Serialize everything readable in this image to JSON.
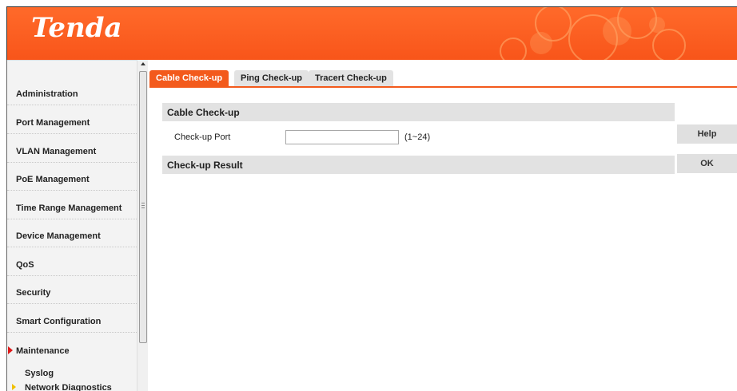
{
  "brand": {
    "logo_text": "Tenda",
    "accent_color": "#f35a1c"
  },
  "sidebar": {
    "items": [
      {
        "label": "Administration"
      },
      {
        "label": "Port Management"
      },
      {
        "label": "VLAN Management"
      },
      {
        "label": "PoE Management"
      },
      {
        "label": "Time Range Management"
      },
      {
        "label": "Device Management"
      },
      {
        "label": "QoS"
      },
      {
        "label": "Security"
      },
      {
        "label": "Smart Configuration"
      },
      {
        "label": "Maintenance",
        "expanded": true
      }
    ],
    "subitems": [
      {
        "label": "Syslog"
      },
      {
        "label": "Network Diagnostics",
        "selected": true
      }
    ]
  },
  "tabs": [
    {
      "label": "Cable Check-up",
      "active": true
    },
    {
      "label": "Ping Check-up",
      "active": false
    },
    {
      "label": "Tracert Check-up",
      "active": false
    }
  ],
  "main": {
    "section1_title": "Cable Check-up",
    "port_label": "Check-up Port",
    "port_value": "",
    "port_hint": "(1~24)",
    "section2_title": "Check-up Result"
  },
  "buttons": {
    "help_label": "Help",
    "ok_label": "OK"
  }
}
